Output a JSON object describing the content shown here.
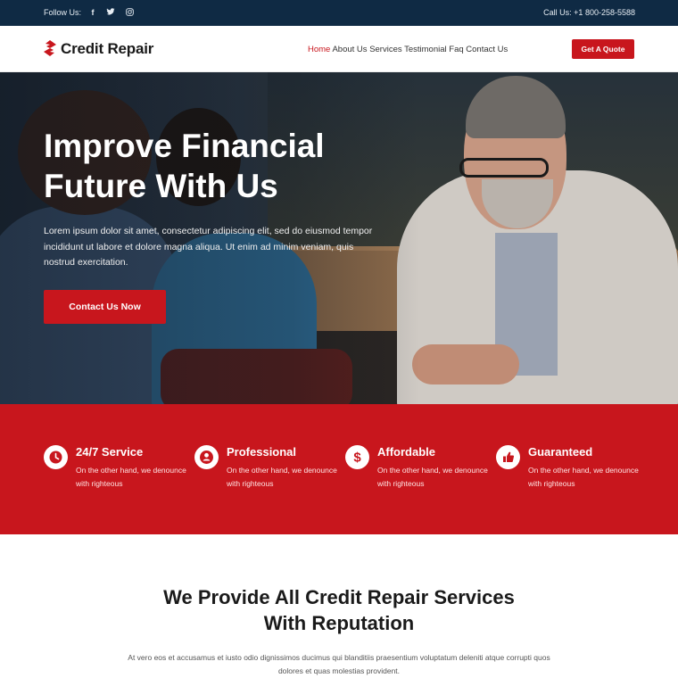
{
  "topbar": {
    "follow_label": "Follow Us:",
    "social_icons": [
      "facebook-icon",
      "twitter-icon",
      "instagram-icon"
    ],
    "call_label": "Call Us: +1 800-258-5588"
  },
  "brand": {
    "name": "Credit Repair",
    "accent": "#c8161d",
    "dark": "#0f2a44"
  },
  "nav": {
    "items": [
      {
        "label": "Home",
        "active": true
      },
      {
        "label": "About Us"
      },
      {
        "label": "Services"
      },
      {
        "label": "Testimonial"
      },
      {
        "label": "Faq"
      },
      {
        "label": "Contact Us"
      }
    ],
    "cta_label": "Get A Quote"
  },
  "hero": {
    "title": "Improve Financial Future With Us",
    "text": "Lorem ipsum dolor sit amet, consectetur adipiscing elit, sed do eiusmod tempor incididunt ut labore et dolore magna aliqua. Ut enim ad minim veniam, quis nostrud exercitation.",
    "cta_label": "Contact Us Now"
  },
  "features": [
    {
      "icon": "clock-icon",
      "title": "24/7 Service",
      "desc": "On the other hand, we denounce with righteous"
    },
    {
      "icon": "user-icon",
      "title": "Professional",
      "desc": "On the other hand, we denounce with righteous"
    },
    {
      "icon": "dollar-icon",
      "title": "Affordable",
      "desc": "On the other hand, we denounce with righteous"
    },
    {
      "icon": "thumbs-up-icon",
      "title": "Guaranteed",
      "desc": "On the other hand, we denounce with righteous"
    }
  ],
  "services": {
    "title_line1": "We Provide All Credit Repair Services",
    "title_line2": "With Reputation",
    "text": "At vero eos et accusamus et iusto odio dignissimos ducimus qui blanditiis praesentium voluptatum deleniti atque corrupti quos dolores et quas molestias provident."
  }
}
